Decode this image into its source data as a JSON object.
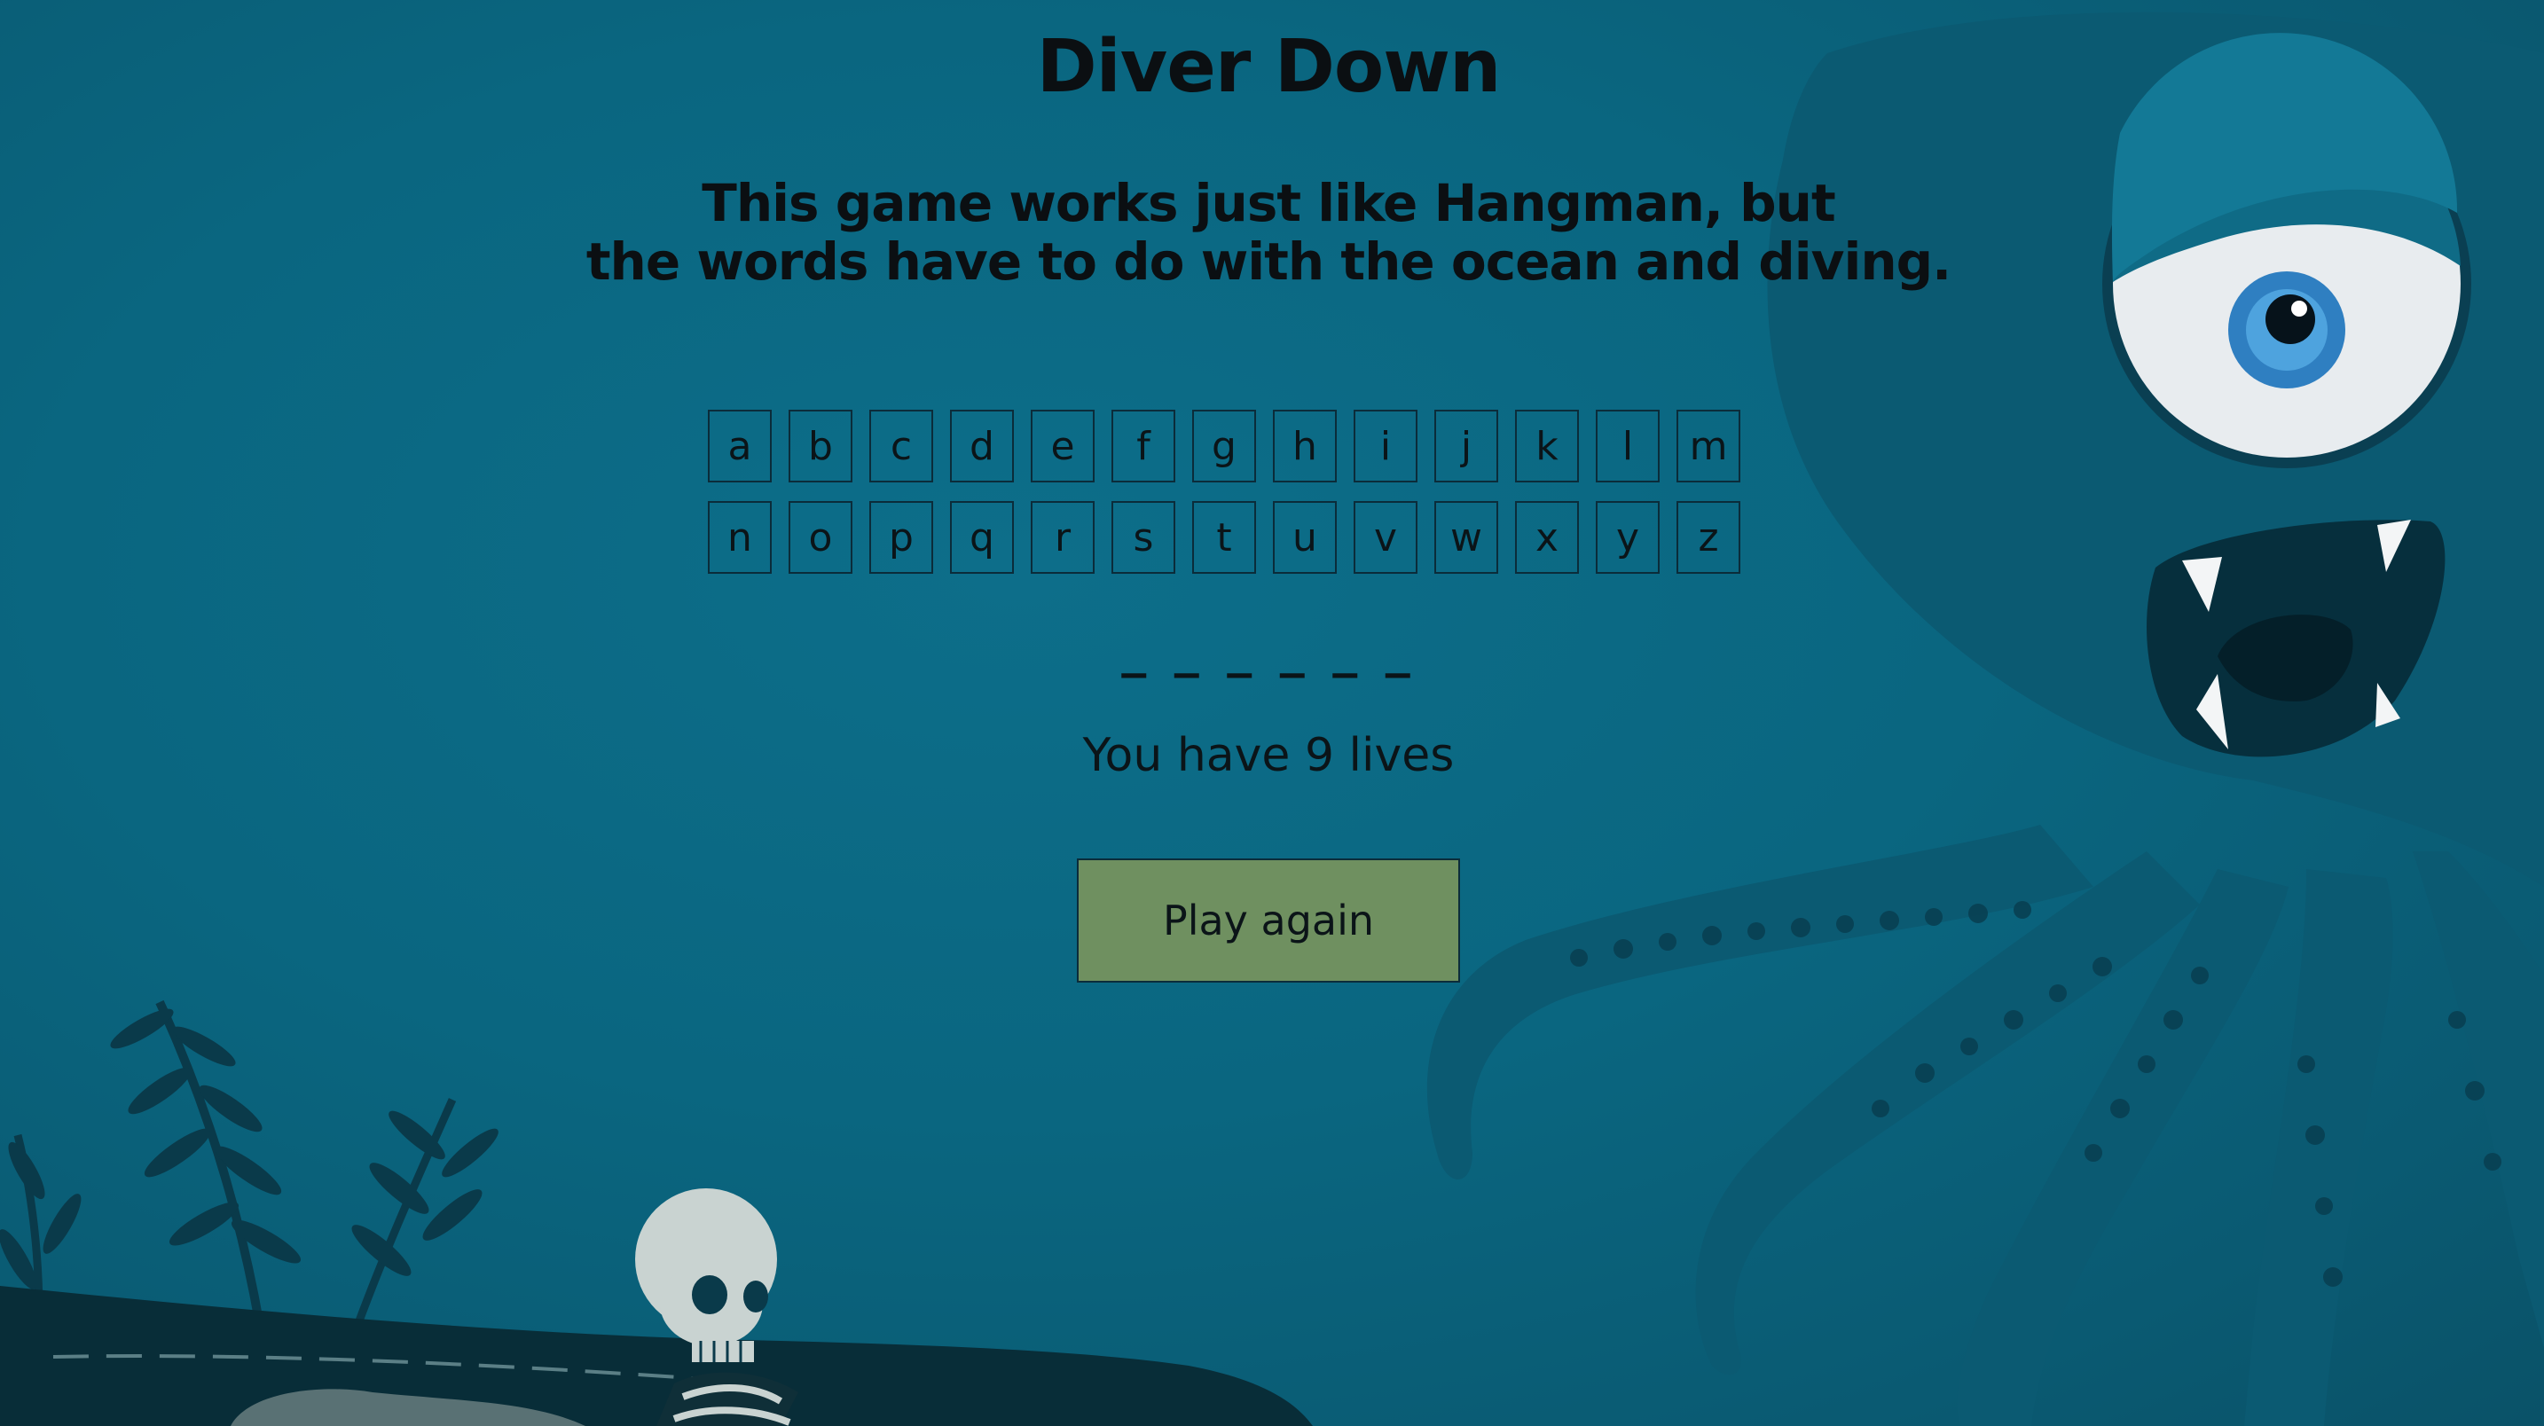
{
  "game": {
    "title": "Diver Down",
    "description_line1": "This game works just like Hangman, but",
    "description_line2": "the words have to do with the ocean and diving.",
    "keyboard_row1": [
      "a",
      "b",
      "c",
      "d",
      "e",
      "f",
      "g",
      "h",
      "i",
      "j",
      "k",
      "l",
      "m"
    ],
    "keyboard_row2": [
      "n",
      "o",
      "p",
      "q",
      "r",
      "s",
      "t",
      "u",
      "v",
      "w",
      "x",
      "y",
      "z"
    ],
    "word_display": "_ _ _ _ _ _",
    "lives_text": "You have 9 lives",
    "play_again_label": "Play again"
  },
  "colors": {
    "water": "#0a6680",
    "button": "#6f9060",
    "text": "#0b1418"
  },
  "icons": [
    "octopus-illustration",
    "skeleton-illustration",
    "seaweed-illustration",
    "seabed-rock"
  ]
}
